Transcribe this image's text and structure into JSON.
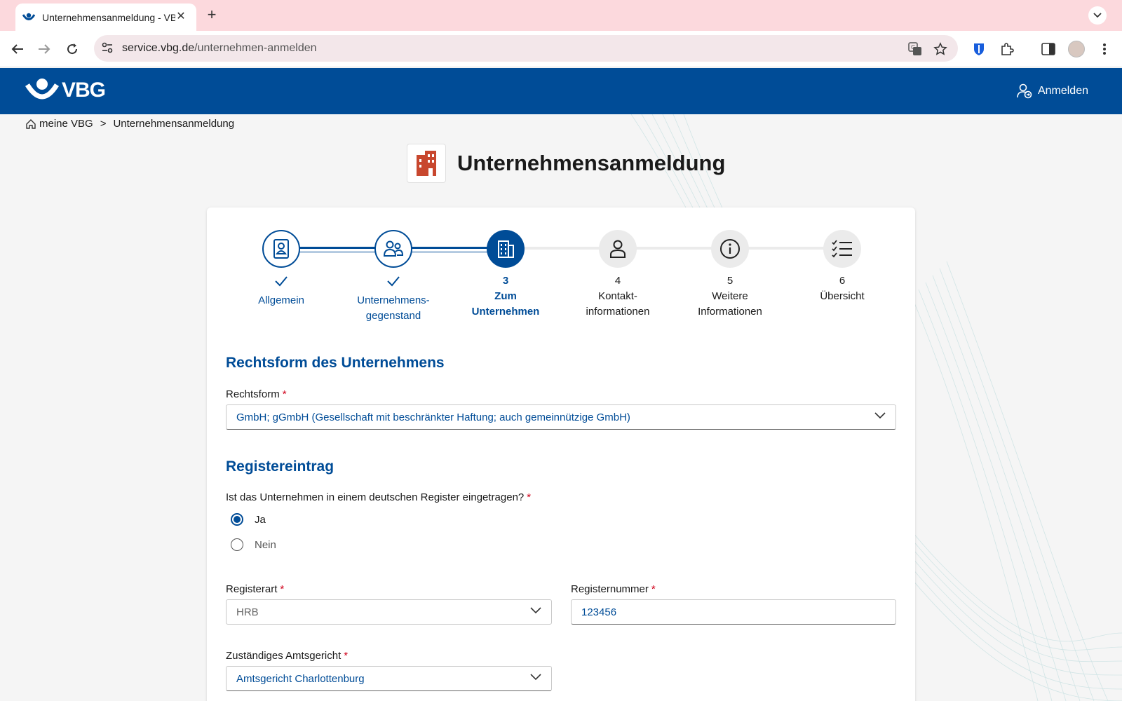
{
  "browser": {
    "tab_title": "Unternehmensanmeldung - VBG",
    "url_host": "service.vbg.de",
    "url_path": "/unternehmen-anmelden"
  },
  "header": {
    "logo_text": "VBG",
    "login_label": "Anmelden",
    "brand_color": "#004c97"
  },
  "breadcrumb": {
    "home": "meine VBG",
    "separator": ">",
    "current": "Unternehmensanmeldung"
  },
  "page_title": "Unternehmensanmeldung",
  "stepper": {
    "steps": [
      {
        "number": "",
        "label_lines": [
          "Allgemein",
          ""
        ],
        "state": "done",
        "icon": "contact-card-icon"
      },
      {
        "number": "",
        "label_lines": [
          "Unternehmens-",
          "gegenstand"
        ],
        "state": "done",
        "icon": "people-icon"
      },
      {
        "number": "3",
        "label_lines": [
          "Zum",
          "Unternehmen"
        ],
        "state": "active",
        "icon": "building-icon"
      },
      {
        "number": "4",
        "label_lines": [
          "Kontakt-",
          "informationen"
        ],
        "state": "todo",
        "icon": "person-icon"
      },
      {
        "number": "5",
        "label_lines": [
          "Weitere",
          "Informationen"
        ],
        "state": "todo",
        "icon": "info-icon"
      },
      {
        "number": "6",
        "label_lines": [
          "Übersicht",
          ""
        ],
        "state": "todo",
        "icon": "checklist-icon"
      }
    ]
  },
  "form": {
    "rechtsform_section": "Rechtsform des Unternehmens",
    "rechtsform_label": "Rechtsform",
    "rechtsform_value": "GmbH; gGmbH (Gesellschaft mit beschränkter Haftung; auch gemeinnützige GmbH)",
    "register_section": "Registereintrag",
    "register_question": "Ist das Unternehmen in einem deutschen Register eingetragen?",
    "radio_yes": "Ja",
    "radio_no": "Nein",
    "radio_selected": "Ja",
    "registerart_label": "Registerart",
    "registerart_value": "HRB",
    "registernummer_label": "Registernummer",
    "registernummer_value": "123456",
    "amtsgericht_label": "Zuständiges Amtsgericht",
    "amtsgericht_value": "Amtsgericht Charlottenburg",
    "required_marker": "*"
  }
}
